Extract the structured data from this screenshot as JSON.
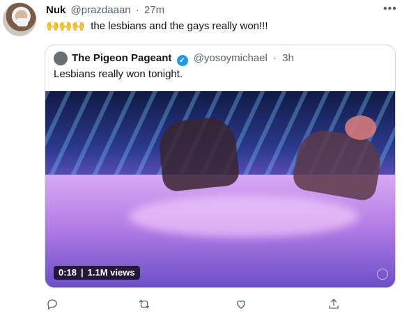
{
  "tweet": {
    "author_name": "Nuk",
    "author_handle": "@prazdaaan",
    "separator": "·",
    "time": "27m",
    "emojis": "🙌🙌🙌",
    "text": "the lesbians and the gays really won!!!",
    "more_icon": "more-dots-icon"
  },
  "quote": {
    "author_name": "The Pigeon Pageant",
    "verified_icon": "verified-badge-icon",
    "author_handle": "@yosoymichael",
    "separator": "·",
    "time": "3h",
    "text": "Lesbians really won tonight.",
    "video": {
      "duration": "0:18",
      "views": "1.1M views"
    }
  },
  "actions": [
    {
      "icon": "reply-icon"
    },
    {
      "icon": "retweet-icon"
    },
    {
      "icon": "like-icon"
    },
    {
      "icon": "share-icon"
    }
  ],
  "colors": {
    "text_primary": "#0f1419",
    "text_secondary": "#536471",
    "border": "#cfd9de",
    "verified": "#1d9bf0"
  }
}
